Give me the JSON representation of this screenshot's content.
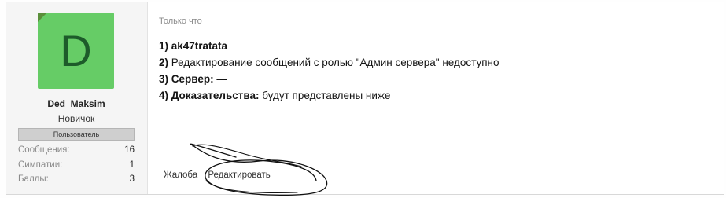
{
  "author": {
    "avatar_letter": "D",
    "avatar_color": "#66cc66",
    "username": "Ded_Maksim",
    "title": "Новичок",
    "banner": "Пользователь",
    "stats": [
      {
        "label": "Сообщения:",
        "value": "16"
      },
      {
        "label": "Симпатии:",
        "value": "1"
      },
      {
        "label": "Баллы:",
        "value": "3"
      }
    ]
  },
  "post": {
    "time": "Только что",
    "line1_prefix": "1) ",
    "line1_value": "ak47tratata",
    "line2_prefix": "2)",
    "line2_text": " Редактирование сообщений с ролью \"Админ сервера\" недоступно",
    "line3": "3) Сервер: —",
    "line4_label": "4) Доказательства:",
    "line4_text": " будут представлены ниже"
  },
  "actions": {
    "report": "Жалоба",
    "edit": "Редактировать"
  }
}
